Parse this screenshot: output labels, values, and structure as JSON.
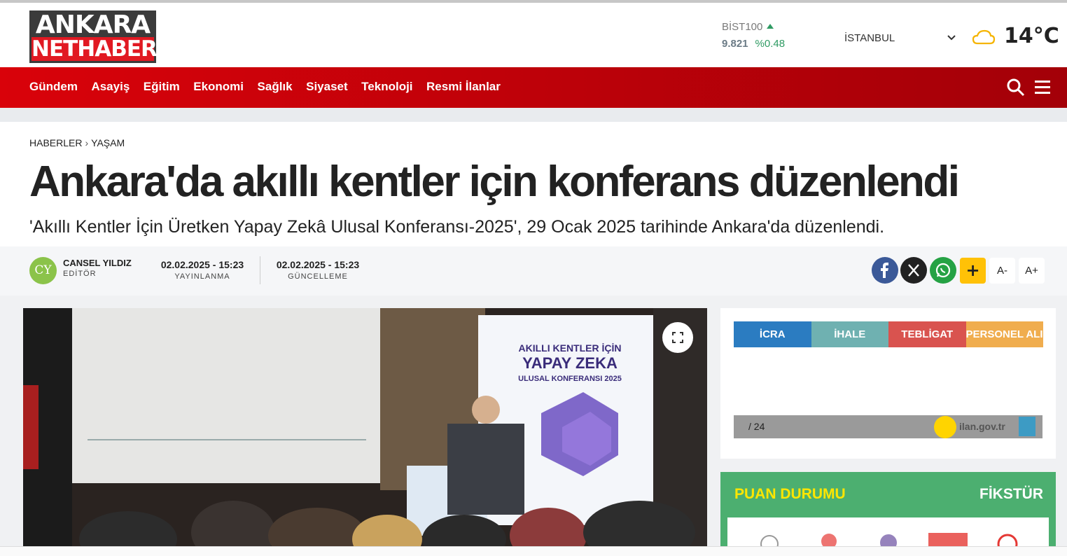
{
  "header": {
    "logo_line1": "ANKARA",
    "logo_line2": "NETHABER",
    "bist_label": "BİST100",
    "bist_value": "9.821",
    "bist_change": "%0.48",
    "city": "İSTANBUL",
    "temperature": "14°C",
    "weather_icon": "cloud-sun-icon"
  },
  "nav": {
    "items": [
      "Gündem",
      "Asayiş",
      "Eğitim",
      "Ekonomi",
      "Sağlık",
      "Siyaset",
      "Teknoloji",
      "Resmi İlanlar"
    ]
  },
  "article": {
    "breadcrumb_home": "HABERLER",
    "breadcrumb_section": "YAŞAM",
    "title": "Ankara'da akıllı kentler için konferans düzenlendi",
    "subtitle": "'Akıllı Kentler İçin Üretken Yapay Zekâ Ulusal Konferansı-2025', 29 Ocak 2025 tarihinde Ankara'da düzenlendi.",
    "author_initials": "CY",
    "author_name": "CANSEL YILDIZ",
    "author_role": "EDİTÖR",
    "published_date": "02.02.2025 - 15:23",
    "published_label": "YAYINLANMA",
    "updated_date": "02.02.2025 - 15:23",
    "updated_label": "GÜNCELLEME",
    "font_smaller": "A-",
    "font_larger": "A+",
    "plus": "+"
  },
  "photo": {
    "banner_line1": "AKILLI KENTLER İÇİN",
    "banner_line2": "YAPAY ZEKA",
    "banner_line3": "ULUSAL KONFERANSI 2025"
  },
  "ilan_widget": {
    "tabs": [
      "İCRA",
      "İHALE",
      "TEBLİGAT",
      "PERSONEL ALIMI"
    ],
    "tab_colors": [
      "#2b7cc1",
      "#6fb1b1",
      "#d9534f",
      "#f0ad4e"
    ],
    "page": "/ 24",
    "brand": "ilan.gov.tr"
  },
  "standings": {
    "title": "PUAN DURUMU",
    "fixture": "FİKSTÜR"
  },
  "colors": {
    "brand_red": "#d9020a",
    "facebook": "#3b5998",
    "twitter": "#222222",
    "whatsapp": "#25a244",
    "accent_yellow": "#ffc107"
  }
}
